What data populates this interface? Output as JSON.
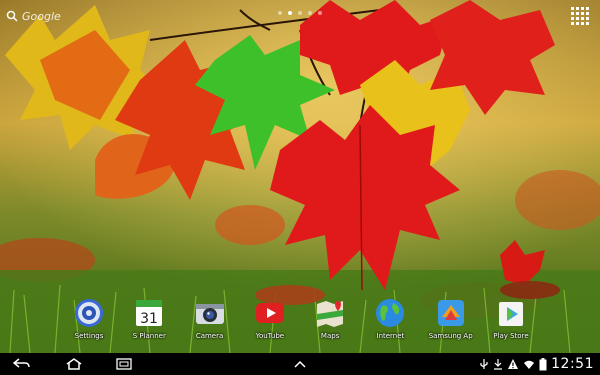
{
  "search": {
    "label": "Google"
  },
  "pages": {
    "count": 5,
    "active": 2
  },
  "dock": {
    "apps": [
      {
        "label": "Settings",
        "icon": "settings-icon"
      },
      {
        "label": "S Planner",
        "icon": "calendar-icon",
        "badge": "31"
      },
      {
        "label": "Camera",
        "icon": "camera-icon"
      },
      {
        "label": "YouTube",
        "icon": "youtube-icon"
      },
      {
        "label": "Maps",
        "icon": "maps-icon"
      },
      {
        "label": "Internet",
        "icon": "globe-icon"
      },
      {
        "label": "Samsung Ap",
        "icon": "samsung-apps-icon"
      },
      {
        "label": "Play Store",
        "icon": "play-store-icon"
      }
    ]
  },
  "status": {
    "time": "12:51"
  },
  "colors": {
    "navbar": "#000000",
    "leaf_red": "#e01a1a",
    "leaf_orange": "#f06a1a",
    "leaf_green": "#3ec02a",
    "grass": "#5a8a1e"
  }
}
